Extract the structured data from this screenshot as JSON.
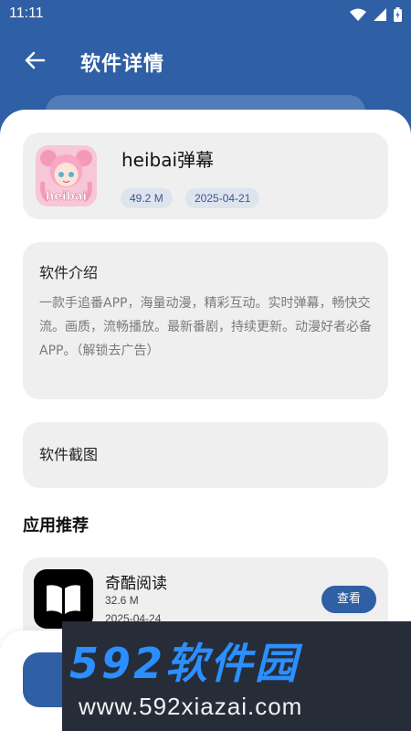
{
  "status_bar": {
    "time": "11:11"
  },
  "header": {
    "title": "软件详情",
    "back_icon": "arrow-left-icon"
  },
  "app": {
    "name": "heibai弹幕",
    "size": "49.2 M",
    "date": "2025-04-21",
    "icon_text": "heibai"
  },
  "intro": {
    "heading": "软件介绍",
    "text": "一款手追番APP，海量动漫，精彩互动。实时弹幕，畅快交流。画质，流畅播放。最新番剧，持续更新。动漫好者必备APP。（解锁去广告）"
  },
  "screenshots": {
    "heading": "软件截图"
  },
  "recommend": {
    "heading": "应用推荐",
    "items": [
      {
        "name": "奇酷阅读",
        "size": "32.6 M",
        "date": "2025-04-24",
        "button": "查看"
      }
    ]
  },
  "watermark": {
    "brand": "592软件园",
    "url": "www.592xiazai.com"
  },
  "colors": {
    "primary": "#2f5fa4",
    "card": "#efefef",
    "chip_bg": "#dde4ee",
    "chip_text": "#3a5a8c"
  }
}
